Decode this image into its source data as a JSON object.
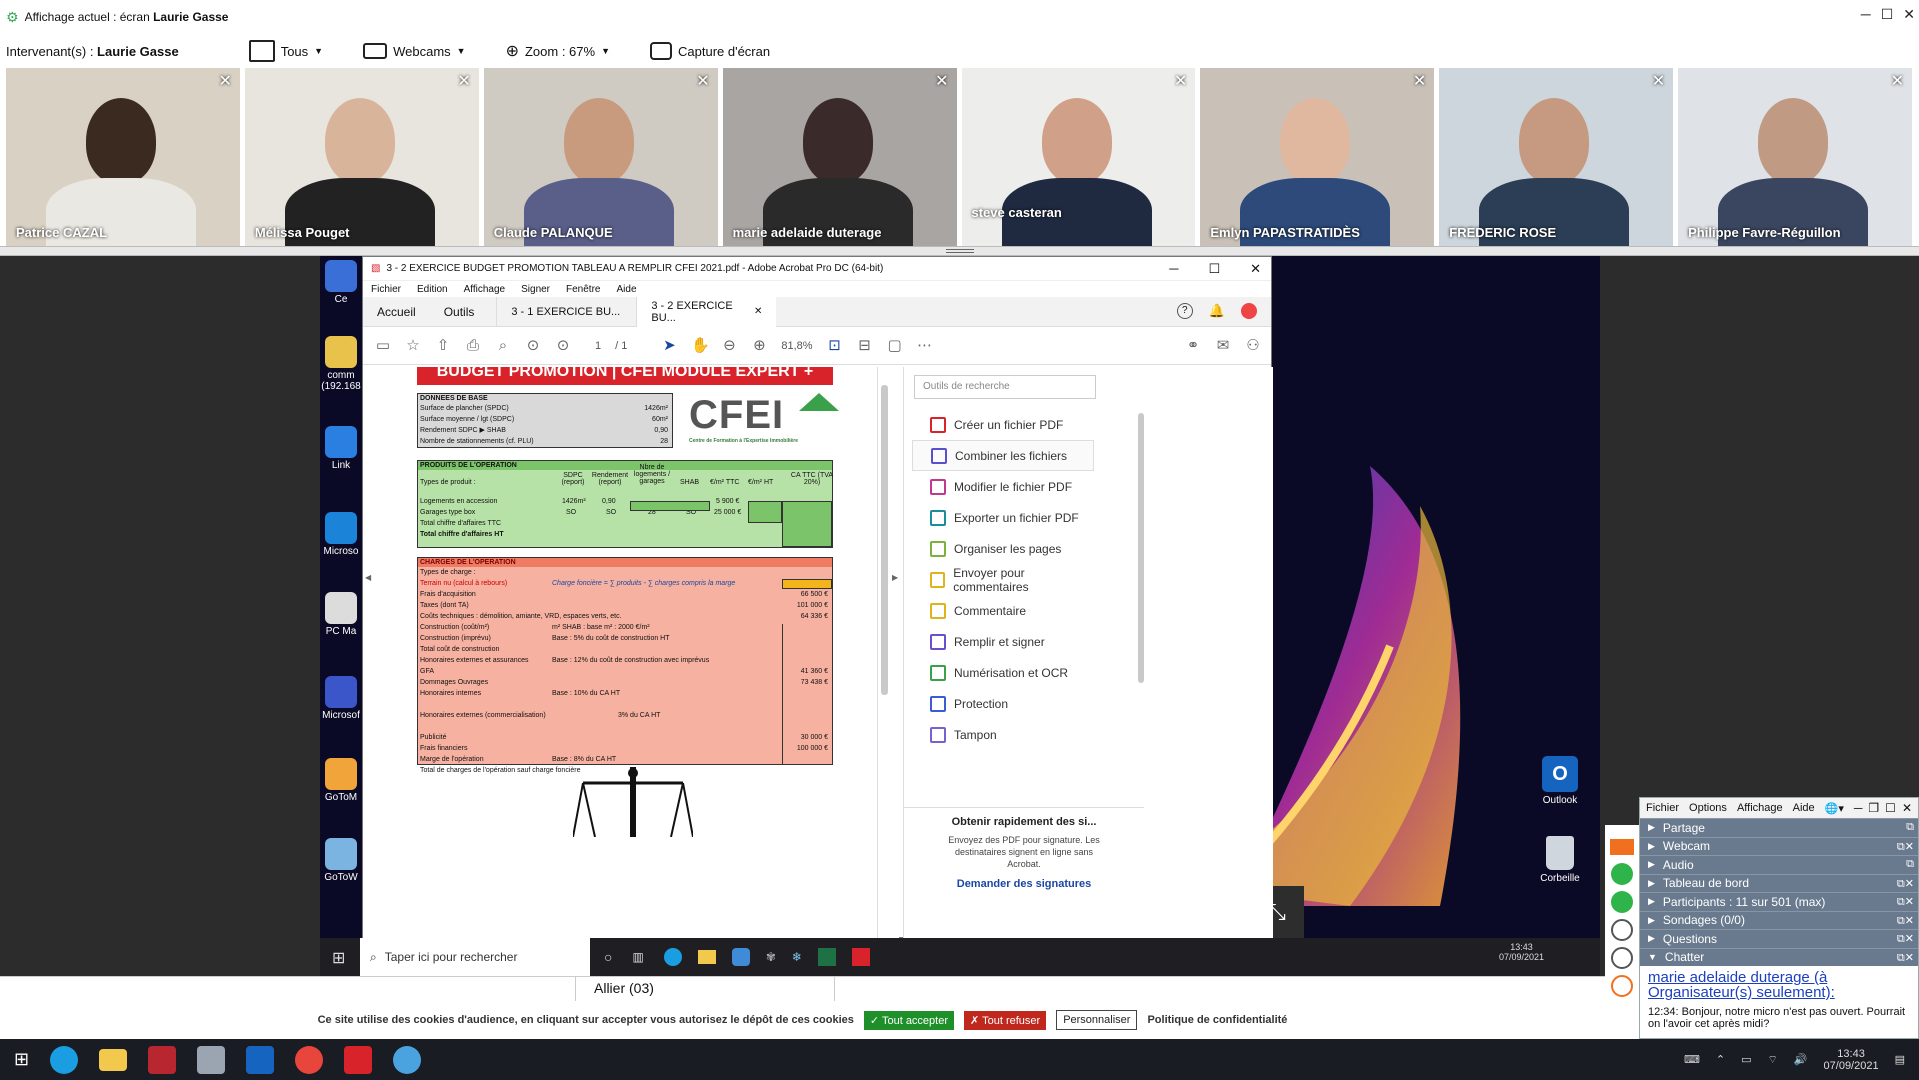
{
  "titlebar": {
    "prefix": "Affichage actuel : écran ",
    "presenter": "Laurie Gasse"
  },
  "toolbar": {
    "speakers_label": "Intervenant(s) : ",
    "speaker": "Laurie Gasse",
    "all": "Tous",
    "webcams": "Webcams",
    "zoom": "Zoom : 67%",
    "capture": "Capture d'écran"
  },
  "cams": [
    {
      "name": "Patrice CAZAL",
      "bg": "#d9d2c4",
      "skin": "#3b2a20",
      "shirt": "#eae8e2"
    },
    {
      "name": "Mélissa Pouget",
      "bg": "#e8e4de",
      "skin": "#d8b49a",
      "shirt": "#222222"
    },
    {
      "name": "Claude PALANQUE",
      "bg": "#cfcac2",
      "skin": "#c89a7e",
      "shirt": "#5a5f8a"
    },
    {
      "name": "marie adelaide duterage",
      "bg": "#a9a5a3",
      "skin": "#3a2a2a",
      "shirt": "#2a2a2a"
    },
    {
      "name": "steve casteran",
      "bg": "#ededeb",
      "skin": "#d0a188",
      "shirt": "#1f2a40"
    },
    {
      "name": "Emlyn PAPASTRATIDÈS",
      "bg": "#c9c1b7",
      "skin": "#e0b8a0",
      "shirt": "#2d4a7a"
    },
    {
      "name": "FREDERIC ROSE",
      "bg": "#cdd6dc",
      "skin": "#c69a80",
      "shirt": "#2b3e55"
    },
    {
      "name": "Philippe Favre-Réguillon",
      "bg": "#dfe2e6",
      "skin": "#c09a82",
      "shirt": "#3a4660"
    }
  ],
  "acrobat": {
    "title": "3 - 2 EXERCICE BUDGET PROMOTION TABLEAU A REMPLIR CFEI 2021.pdf - Adobe Acrobat Pro DC (64-bit)",
    "menu": [
      "Fichier",
      "Edition",
      "Affichage",
      "Signer",
      "Fenêtre",
      "Aide"
    ],
    "tabs": [
      "Accueil",
      "Outils"
    ],
    "doc_tabs": [
      "3 - 1 EXERCICE BU...",
      "3 - 2 EXERCICE BU..."
    ],
    "page": "1",
    "pages": "/ 1",
    "zoom": "81,8%",
    "search_placeholder": "Outils de recherche",
    "tools": [
      {
        "label": "Créer un fichier PDF",
        "color": "#d8232a"
      },
      {
        "label": "Combiner les fichiers",
        "color": "#5a4fcf"
      },
      {
        "label": "Modifier le fichier PDF",
        "color": "#c2388f"
      },
      {
        "label": "Exporter un fichier PDF",
        "color": "#1a8f9a"
      },
      {
        "label": "Organiser les pages",
        "color": "#7bb339"
      },
      {
        "label": "Envoyer pour commentaires",
        "color": "#e0b21c"
      },
      {
        "label": "Commentaire",
        "color": "#e0b21c"
      },
      {
        "label": "Remplir et signer",
        "color": "#6a4fcf"
      },
      {
        "label": "Numérisation et OCR",
        "color": "#3aa04a"
      },
      {
        "label": "Protection",
        "color": "#3b5bd8"
      },
      {
        "label": "Tampon",
        "color": "#7a5fcf"
      }
    ],
    "promo_title": "Obtenir rapidement des si...",
    "promo_text": "Envoyez des PDF pour signature. Les destinataires signent en ligne sans Acrobat.",
    "promo_link": "Demander des signatures"
  },
  "pdf": {
    "banner": "BUDGET PROMOTION | CFEI MODULE EXPERT +",
    "logo": "CFEI",
    "logo_sub": "Centre de Formation à l'Expertise Immobilière",
    "base_title": "DONNEES DE BASE",
    "base_rows": [
      [
        "Surface de plancher (SPDC)",
        "1426m²"
      ],
      [
        "Surface moyenne / lgt (SDPC)",
        "60m²"
      ],
      [
        "Rendement SDPC ▶ SHAB",
        "0,90"
      ],
      [
        "Nombre de stationnements (cf. PLU)",
        "28"
      ]
    ],
    "prod_title": "PRODUITS DE L'OPERATION",
    "prod_head": [
      "Types de produit :",
      "SDPC (report)",
      "Rendement (report)",
      "Nbre de logements / garages",
      "SHAB",
      "€/m² TTC",
      "€/m² HT",
      "CA TTC (TVA 20%)"
    ],
    "prod_rows": [
      [
        "Logements en accession",
        "1426m²",
        "0,90",
        "",
        "",
        "5 900 €"
      ],
      [
        "Garages type box",
        "SO",
        "SO",
        "28",
        "SO",
        "25 000 €"
      ],
      [
        "Total chiffre d'affaires TTC",
        "",
        "",
        "",
        "",
        ""
      ],
      [
        "Total chiffre d'affaires HT",
        "",
        "",
        "",
        "",
        ""
      ]
    ],
    "charges_title": "CHARGES DE L'OPERATION",
    "charges_rows": [
      [
        "Types de charge :",
        "",
        ""
      ],
      [
        "Terrain nu (calcul à rebours)",
        "Charge foncière = ∑ produits - ∑ charges compris la marge",
        ""
      ],
      [
        "Frais d'acquisition",
        "",
        "66 500 €"
      ],
      [
        "Taxes (dont TA)",
        "",
        "101 000 €"
      ],
      [
        "Coûts techniques : démolition, amiante, VRD, espaces verts, etc.",
        "",
        "64 336 €"
      ],
      [
        "Construction (coût/m²)",
        "m² SHAB :          base m² :      2000 €/m²",
        ""
      ],
      [
        "Construction (imprévu)",
        "Base :        5% du coût de construction HT",
        ""
      ],
      [
        "Total coût de construction",
        "",
        ""
      ],
      [
        "Honoraires externes et assurances",
        "Base :        12% du coût de construction avec imprévus",
        ""
      ],
      [
        "GFA",
        "",
        "41 360 €"
      ],
      [
        "Dommages Ouvrages",
        "",
        "73 438 €"
      ],
      [
        "Honoraires internes",
        "Base :        10% du CA HT",
        ""
      ],
      [
        "",
        "",
        ""
      ],
      [
        "Honoraires externes (commercialisation)",
        "3% du CA HT",
        ""
      ],
      [
        "",
        "",
        ""
      ],
      [
        "Publicité",
        "",
        "30 000 €"
      ],
      [
        "Frais financiers",
        "",
        "100 000 €"
      ],
      [
        "Marge de l'opération",
        "Base :        8% du CA HT",
        ""
      ],
      [
        "Total de charges de l'opération sauf charge foncière",
        "",
        ""
      ]
    ]
  },
  "desktop_icons": [
    {
      "label": "Ce",
      "color": "#3b6fd8"
    },
    {
      "label": "comm (192.168",
      "color": "#e8c24a"
    },
    {
      "label": "Link",
      "color": "#2a7fe0"
    },
    {
      "label": "Microso",
      "color": "#1b84d8"
    },
    {
      "label": "PC Ma",
      "color": "#dcdcdc"
    },
    {
      "label": "Microsof",
      "color": "#3b56c9"
    },
    {
      "label": "GoToM",
      "color": "#f0a43a"
    },
    {
      "label": "GoToW",
      "color": "#7bb4e0"
    }
  ],
  "desk_right": {
    "outlook": "Outlook",
    "bin": "Corbeille"
  },
  "shared_taskbar": {
    "search": "Taper ici pour rechercher",
    "time": "13:43",
    "date": "07/09/2021"
  },
  "allier": "Allier (03)",
  "cookies": {
    "text": "Ce site utilise des cookies d'audience, en cliquant sur accepter vous autorisez le dépôt de ces cookies",
    "accept": "✓ Tout accepter",
    "refuse": "✗ Tout refuser",
    "custom": "Personnaliser",
    "policy": "Politique de confidentialité"
  },
  "cp": {
    "menu": [
      "Fichier",
      "Options",
      "Affichage",
      "Aide"
    ],
    "sections": [
      {
        "label": "Partage",
        "open": false
      },
      {
        "label": "Webcam",
        "open": false
      },
      {
        "label": "Audio",
        "open": false
      },
      {
        "label": "Tableau de bord",
        "open": false
      },
      {
        "label": "Participants :  11 sur 501 (max)",
        "open": false
      },
      {
        "label": "Sondages (0/0)",
        "open": false
      },
      {
        "label": "Questions",
        "open": false
      },
      {
        "label": "Chatter",
        "open": true
      }
    ],
    "chat_who": "marie adelaide duterage (à Organisateur(s) seulement):",
    "chat_msg": "12:34: Bonjour, notre micro n'est pas ouvert. Pourrait on l'avoir cet après midi?"
  },
  "taskbar": {
    "time": "13:43",
    "date": "07/09/2021"
  }
}
